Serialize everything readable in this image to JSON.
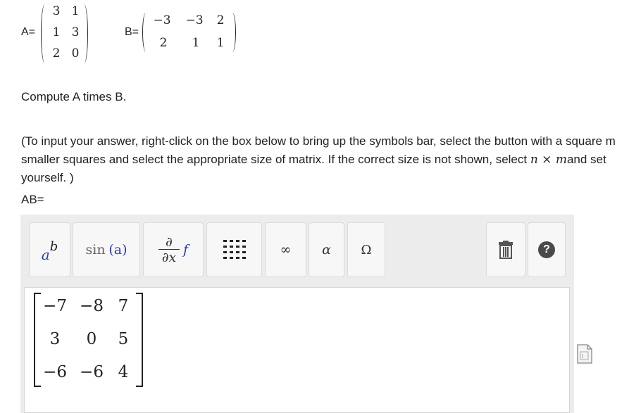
{
  "matrix_a": {
    "label": "A=",
    "rows": [
      [
        "3",
        "1"
      ],
      [
        "1",
        "3"
      ],
      [
        "2",
        "0"
      ]
    ]
  },
  "matrix_b": {
    "label": "B=",
    "rows": [
      [
        "−3",
        "−3",
        "2"
      ],
      [
        "2",
        "1",
        "1"
      ]
    ]
  },
  "question": "Compute A times B.",
  "instructions": {
    "line1": "(To input your answer, right-click on the box below to bring up the symbols bar, select the button with a square m",
    "line2_start": "smaller squares and select the appropriate size of matrix. If the correct size is not shown, select ",
    "line2_math": "n × m",
    "line2_end": "and set",
    "line3": "yourself. )"
  },
  "answer_label": "AB=",
  "toolbar": {
    "superscript": {
      "base": "a",
      "exp": "b"
    },
    "function": {
      "name": "sin",
      "arg": "(a)"
    },
    "derivative": {
      "num": "∂",
      "den": "∂x",
      "fn": "f"
    },
    "infinity": "∞",
    "alpha": "α",
    "omega": "Ω",
    "help": "?"
  },
  "answer_matrix": [
    [
      "−7",
      "−8",
      "7"
    ],
    [
      "3",
      "0",
      "5"
    ],
    [
      "−6",
      "−6",
      "4"
    ]
  ],
  "colors": {
    "superscript_base": "#2b3cb0",
    "superscript_exp": "#222222",
    "function_arg": "#2b3cb0",
    "help_bg": "#4a4a4a"
  }
}
